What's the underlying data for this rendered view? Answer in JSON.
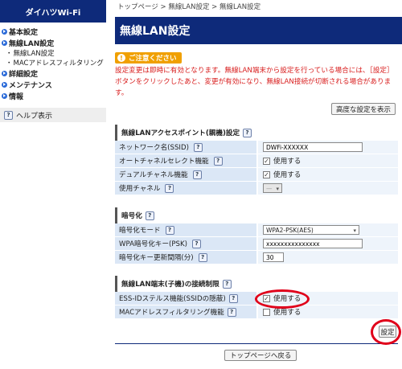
{
  "sidebar": {
    "brand": "ダイハツWi-Fi",
    "items": [
      {
        "label": "基本設定"
      },
      {
        "label": "無線LAN設定"
      }
    ],
    "subitems": [
      {
        "label": "無線LAN設定"
      },
      {
        "label": "MACアドレスフィルタリング"
      }
    ],
    "items2": [
      {
        "label": "詳細設定"
      },
      {
        "label": "メンテナンス"
      },
      {
        "label": "情報"
      }
    ],
    "help": "ヘルプ表示"
  },
  "breadcrumb": "トップページ > 無線LAN設定 > 無線LAN設定",
  "page_title": "無線LAN設定",
  "notice": {
    "badge": "ご注意ください",
    "text": "設定変更は即時に有効となります。無線LAN端末から設定を行っている場合には、［設定］ボタンをクリックしたあと、変更が有効になり、無線LAN接続が切断される場合があります。"
  },
  "advanced_button": "高度な設定を表示",
  "help_glyph": "?",
  "ap_section": {
    "title": "無線LANアクセスポイント(親機)設定",
    "rows": [
      {
        "label": "ネットワーク名(SSID)",
        "value": "DWFi-XXXXXX"
      },
      {
        "label": "オートチャネルセレクト機能",
        "value": "使用する"
      },
      {
        "label": "デュアルチャネル機能",
        "value": "使用する"
      },
      {
        "label": "使用チャネル",
        "value": "—"
      }
    ]
  },
  "enc_section": {
    "title": "暗号化",
    "rows": [
      {
        "label": "暗号化モード",
        "value": "WPA2-PSK(AES)"
      },
      {
        "label": "WPA暗号化キー(PSK)",
        "value": "xxxxxxxxxxxxxxx"
      },
      {
        "label": "暗号化キー更新間隔(分)",
        "value": "30"
      }
    ]
  },
  "limit_section": {
    "title": "無線LAN端末(子機)の接続制限",
    "rows": [
      {
        "label": "ESS-IDステルス機能(SSIDの隠蔽)",
        "value": "使用する",
        "checked": true
      },
      {
        "label": "MACアドレスフィルタリング機能",
        "value": "使用する",
        "checked": false
      }
    ]
  },
  "save_button": "設定",
  "back_button": "トップページへ戻る",
  "colors": {
    "header": "#0e2a7a",
    "notice_text": "#d81c1c",
    "badge": "#f0a000",
    "highlight_ring": "#e0001a"
  }
}
